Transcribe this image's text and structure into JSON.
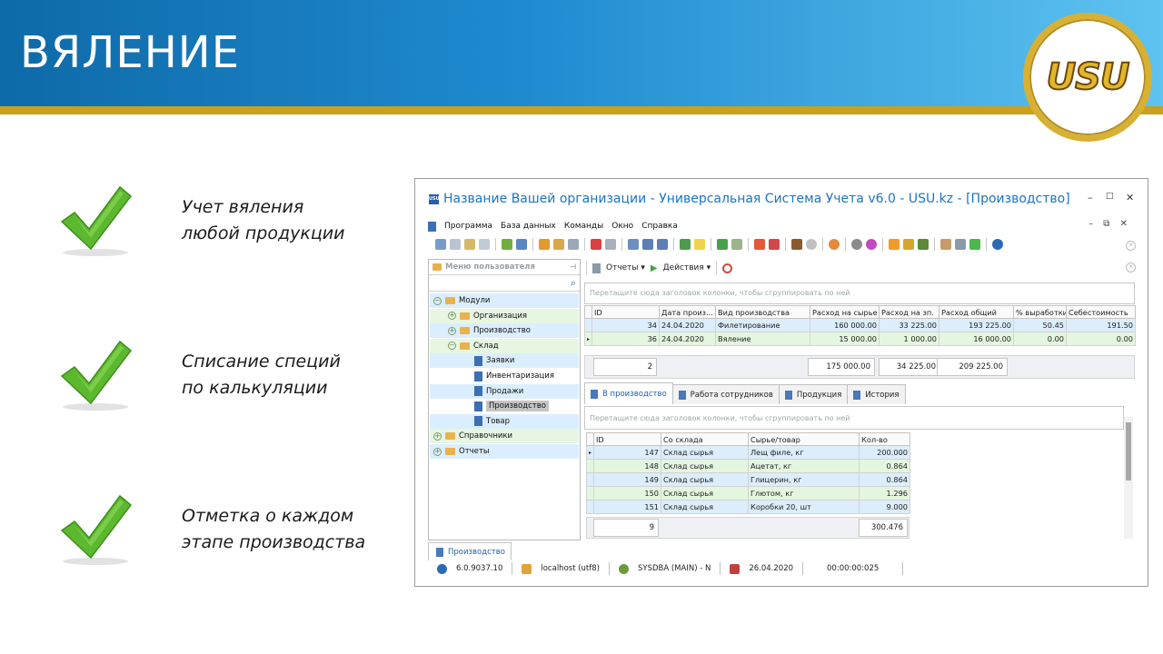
{
  "slide": {
    "title": "ВЯЛЕНИЕ",
    "logo_text": "USU",
    "features": [
      {
        "line1": "Учет вяления",
        "line2": "любой продукции"
      },
      {
        "line1": "Списание специй",
        "line2": "по калькуляции"
      },
      {
        "line1": "Отметка о каждом",
        "line2": "этапе производства"
      }
    ]
  },
  "colors": {
    "banner_start": "#0e6aa8",
    "banner_end": "#5ec3f0",
    "gold": "#c8a11e",
    "check_green": "#5cb82e"
  },
  "window": {
    "title": "Название Вашей организации - Универсальная Система Учета v6.0 - USU.kz - [Производство]",
    "app_icon_text": "USU",
    "controls": {
      "minimize": "–",
      "maximize": "□",
      "close": "✕"
    },
    "menu": [
      "Программа",
      "База данных",
      "Команды",
      "Окно",
      "Справка"
    ],
    "mdi_controls": "– ⧉ ✕"
  },
  "left_panel": {
    "header": "Меню пользователя",
    "tree": [
      {
        "label": "Модули",
        "level": 0,
        "exp": "−",
        "kind": "folder"
      },
      {
        "label": "Организация",
        "level": 1,
        "exp": "+",
        "kind": "folder"
      },
      {
        "label": "Производство",
        "level": 1,
        "exp": "+",
        "kind": "folder"
      },
      {
        "label": "Склад",
        "level": 1,
        "exp": "−",
        "kind": "folder"
      },
      {
        "label": "Заявки",
        "level": 2,
        "kind": "doc"
      },
      {
        "label": "Инвентаризация",
        "level": 2,
        "kind": "doc"
      },
      {
        "label": "Продажи",
        "level": 2,
        "kind": "doc"
      },
      {
        "label": "Производство",
        "level": 2,
        "kind": "doc",
        "selected": true
      },
      {
        "label": "Товар",
        "level": 2,
        "kind": "doc"
      },
      {
        "label": "Справочники",
        "level": 0,
        "exp": "+",
        "kind": "folder"
      },
      {
        "label": "Отчеты",
        "level": 0,
        "exp": "+",
        "kind": "folder"
      }
    ]
  },
  "right_toolbar": {
    "reports": "Отчеты",
    "actions": "Действия"
  },
  "top_grid": {
    "group_hint": "Перетащите сюда заголовок колонки, чтобы сгруппировать по ней",
    "columns": [
      "ID",
      "Дата произ...",
      "Вид производства",
      "Расход на сырье",
      "Расход на зп.",
      "Расход общий",
      "% выработки",
      "Себестоимость"
    ],
    "rows": [
      [
        "34",
        "24.04.2020",
        "Филетирование",
        "160 000.00",
        "33 225.00",
        "193 225.00",
        "50.45",
        "191.50"
      ],
      [
        "36",
        "24.04.2020",
        "Вяление",
        "15 000.00",
        "1 000.00",
        "16 000.00",
        "0.00",
        "0.00"
      ]
    ],
    "totals": {
      "count": "2",
      "raw": "175 000.00",
      "salary": "34 225.00",
      "total": "209 225.00"
    }
  },
  "tabs": [
    "В производство",
    "Работа сотрудников",
    "Продукция",
    "История"
  ],
  "bottom_grid": {
    "group_hint": "Перетащите сюда заголовок колонки, чтобы сгруппировать по ней",
    "columns": [
      "ID",
      "Со склада",
      "Сырье/товар",
      "Кол-во"
    ],
    "rows": [
      [
        "147",
        "Склад сырья",
        "Лещ филе, кг",
        "200.000"
      ],
      [
        "148",
        "Склад сырья",
        "Ацетат, кг",
        "0.864"
      ],
      [
        "149",
        "Склад сырья",
        "Глицерин, кг",
        "0.864"
      ],
      [
        "150",
        "Склад сырья",
        "Глютом, кг",
        "1.296"
      ],
      [
        "151",
        "Склад сырья",
        "Коробки 20, шт",
        "9.000"
      ]
    ],
    "totals": {
      "count": "9",
      "qty": "300.476"
    }
  },
  "bottom_tab": "Производство",
  "status": {
    "version": "6.0.9037.10",
    "server": "localhost (utf8)",
    "user": "SYSDBA (MAIN) - N",
    "date": "26.04.2020",
    "timer": "00:00:00:025"
  }
}
